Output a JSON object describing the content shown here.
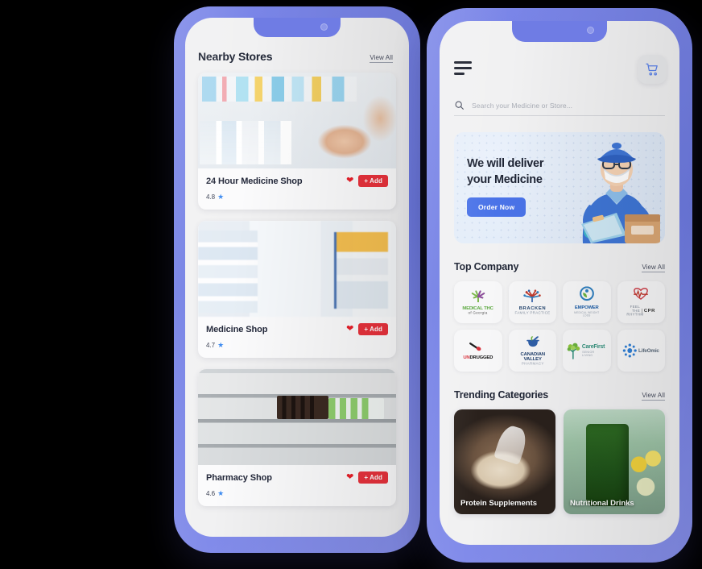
{
  "theme": {
    "frame_color": "#6F7CE4",
    "screen_bg": "#F1F1F2",
    "accent_red": "#E8323C",
    "accent_blue": "#4A73E8",
    "star_blue": "#3D8BF0"
  },
  "left_phone": {
    "header": {
      "title": "Nearby Stores",
      "view_all": "View All"
    },
    "stores": [
      {
        "name": "24 Hour Medicine Shop",
        "rating": "4.8",
        "add_label": "+ Add",
        "favorite_icon": "heart-icon",
        "image": "pharmacy-counter-photo"
      },
      {
        "name": "Medicine Shop",
        "rating": "4.7",
        "add_label": "+ Add",
        "favorite_icon": "heart-icon",
        "image": "store-aisle-photo"
      },
      {
        "name": "Pharmacy Shop",
        "rating": "4.6",
        "add_label": "+ Add",
        "favorite_icon": "heart-icon",
        "image": "pharmacy-shelves-photo"
      }
    ]
  },
  "right_phone": {
    "topbar": {
      "menu_icon": "hamburger-menu-icon",
      "cart_icon": "shopping-cart-icon"
    },
    "search": {
      "icon": "search-icon",
      "placeholder": "Search your Medicine or Store...",
      "value": ""
    },
    "banner": {
      "line1": "We will deliver",
      "line2": "your Medicine",
      "button": "Order Now",
      "illustration": "delivery-person-illustration"
    },
    "top_company": {
      "title": "Top Company",
      "view_all": "View All",
      "logos": [
        {
          "name": "MEDICAL THC of Georgia",
          "line1": "MEDICAL THC",
          "line2": "of Georgia"
        },
        {
          "name": "BRACKEN Family Practice",
          "line1": "BRACKEN",
          "line2": "FAMILY PRACTICE"
        },
        {
          "name": "EMPOWER",
          "line1": "EMPOWER",
          "line2": "MEDICAL WEIGHT LOSS"
        },
        {
          "name": "Feel The Rhythm CPR",
          "line1": "CPR",
          "line2": "FEEL THE RHYTHM"
        },
        {
          "name": "UNDRUGGED",
          "line1": "UNDRUGGED",
          "line2": ""
        },
        {
          "name": "Canadian Valley Pharmacy",
          "line1": "CANADIAN VALLEY",
          "line2": "PHARMACY"
        },
        {
          "name": "CareFirst",
          "line1": "CareFirst",
          "line2": "SENIOR LIVING"
        },
        {
          "name": "LifeOmic",
          "line1": "LifeOmic",
          "line2": ""
        }
      ]
    },
    "trending": {
      "title": "Trending Categories",
      "view_all": "View All",
      "categories": [
        {
          "label": "Protein Supplements",
          "image": "protein-powder-scoop-photo"
        },
        {
          "label": "Nutritional Drinks",
          "image": "green-smoothie-jar-photo"
        }
      ]
    }
  }
}
